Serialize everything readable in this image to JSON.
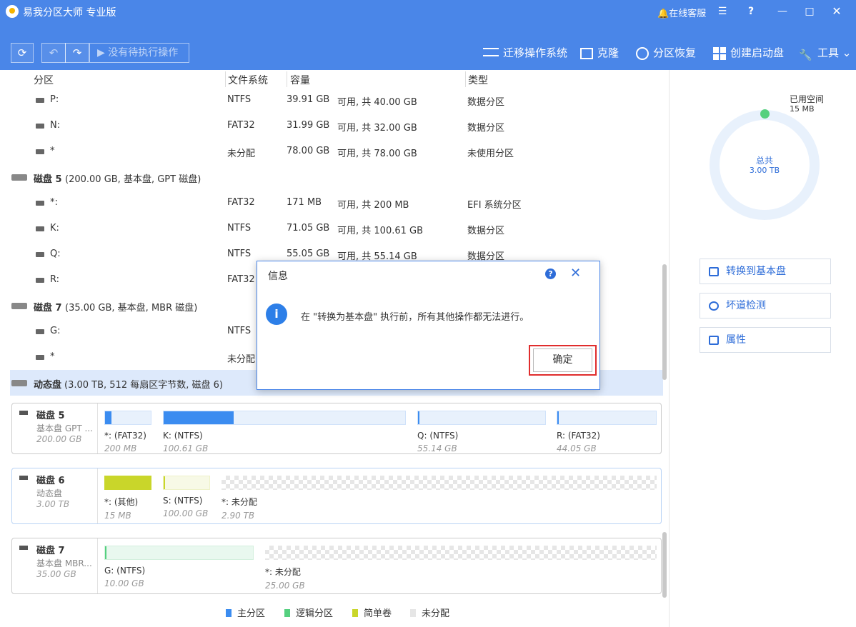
{
  "app": {
    "title": "易我分区大师 专业版",
    "online_service": "在线客服"
  },
  "toolbar": {
    "pending": "没有待执行操作",
    "tools": [
      {
        "label": "迁移操作系统"
      },
      {
        "label": "克隆"
      },
      {
        "label": "分区恢复"
      },
      {
        "label": "创建启动盘"
      },
      {
        "label": "工具"
      }
    ]
  },
  "table": {
    "headers": {
      "partition": "分区",
      "fs": "文件系统",
      "capacity": "容量",
      "type": "类型"
    },
    "rows": [
      {
        "kind": "vol",
        "name": "P:",
        "fs": "NTFS",
        "used": "39.91 GB",
        "cap": "可用, 共 40.00 GB",
        "type": "数据分区"
      },
      {
        "kind": "vol",
        "name": "N:",
        "fs": "FAT32",
        "used": "31.99 GB",
        "cap": "可用, 共 32.00 GB",
        "type": "数据分区"
      },
      {
        "kind": "vol",
        "name": "*",
        "fs": "未分配",
        "used": "78.00 GB",
        "cap": "可用, 共 78.00 GB",
        "type": "未使用分区"
      },
      {
        "kind": "disk",
        "name": "磁盘 5",
        "detail": "(200.00 GB, 基本盘, GPT 磁盘)"
      },
      {
        "kind": "vol",
        "name": "*:",
        "fs": "FAT32",
        "used": "171 MB",
        "cap": "可用, 共 200 MB",
        "type": "EFI 系统分区"
      },
      {
        "kind": "vol",
        "name": "K:",
        "fs": "NTFS",
        "used": "71.05 GB",
        "cap": "可用, 共 100.61 GB",
        "type": "数据分区"
      },
      {
        "kind": "vol",
        "name": "Q:",
        "fs": "NTFS",
        "used": "55.05 GB",
        "cap": "可用, 共 55.14 GB",
        "type": "数据分区"
      },
      {
        "kind": "vol",
        "name": "R:",
        "fs": "FAT32",
        "used": "",
        "cap": "",
        "type": ""
      },
      {
        "kind": "disk",
        "name": "磁盘 7",
        "detail": "(35.00 GB, 基本盘, MBR 磁盘)"
      },
      {
        "kind": "vol",
        "name": "G:",
        "fs": "NTFS",
        "used": "",
        "cap": "",
        "type": ""
      },
      {
        "kind": "vol",
        "name": "*",
        "fs": "未分配",
        "used": "",
        "cap": "",
        "type": ""
      },
      {
        "kind": "disk",
        "name": "动态盘",
        "detail": "(3.00 TB, 512 每扇区字节数, 磁盘 6)",
        "selected": true
      }
    ]
  },
  "side": {
    "used_label": "已用空间",
    "used_value": "15 MB",
    "total_label": "总共",
    "total_value": "3.00 TB",
    "actions": [
      {
        "label": "转换到基本盘"
      },
      {
        "label": "坏道检测"
      },
      {
        "label": "属性"
      }
    ]
  },
  "maps": [
    {
      "name": "磁盘 5",
      "sub": "基本盘 GPT ...",
      "size": "200.00 GB",
      "parts": [
        {
          "name": "*:",
          "fs": "(FAT32)",
          "size": "200 MB",
          "style": "blue",
          "fill": 0.14
        },
        {
          "name": "K:",
          "fs": "(NTFS)",
          "size": "100.61 GB",
          "style": "blue",
          "fill": 0.29
        },
        {
          "name": "Q:",
          "fs": "(NTFS)",
          "size": "55.14 GB",
          "style": "blue",
          "fill": 0.0
        },
        {
          "name": "R:",
          "fs": "(FAT32)",
          "size": "44.05 GB",
          "style": "blue",
          "fill": 0.0
        }
      ]
    },
    {
      "name": "磁盘 6",
      "sub": "动态盘",
      "size": "3.00 TB",
      "parts": [
        {
          "name": "*:",
          "fs": "(其他)",
          "size": "15 MB",
          "style": "yellow",
          "fill": 1.0
        },
        {
          "name": "S:",
          "fs": "(NTFS)",
          "size": "100.00 GB",
          "style": "lightyellow",
          "fill": 0.0
        },
        {
          "name": "*:",
          "fs": "未分配",
          "size": "2.90 TB",
          "style": "unalloc",
          "fill": 0
        }
      ]
    },
    {
      "name": "磁盘 7",
      "sub": "基本盘 MBR...",
      "size": "35.00 GB",
      "parts": [
        {
          "name": "G:",
          "fs": "(NTFS)",
          "size": "10.00 GB",
          "style": "green",
          "fill": 0.0
        },
        {
          "name": "*:",
          "fs": "未分配",
          "size": "25.00 GB",
          "style": "unalloc",
          "fill": 0
        }
      ]
    }
  ],
  "legend": [
    {
      "label": "主分区",
      "color": "#3b8cf0"
    },
    {
      "label": "逻辑分区",
      "color": "#55d07f"
    },
    {
      "label": "简单卷",
      "color": "#c9d62a"
    },
    {
      "label": "未分配",
      "color": "#e6e6e6"
    }
  ],
  "dialog": {
    "title": "信息",
    "message": "在 \"转换为基本盘\" 执行前，所有其他操作都无法进行。",
    "ok": "确定"
  }
}
